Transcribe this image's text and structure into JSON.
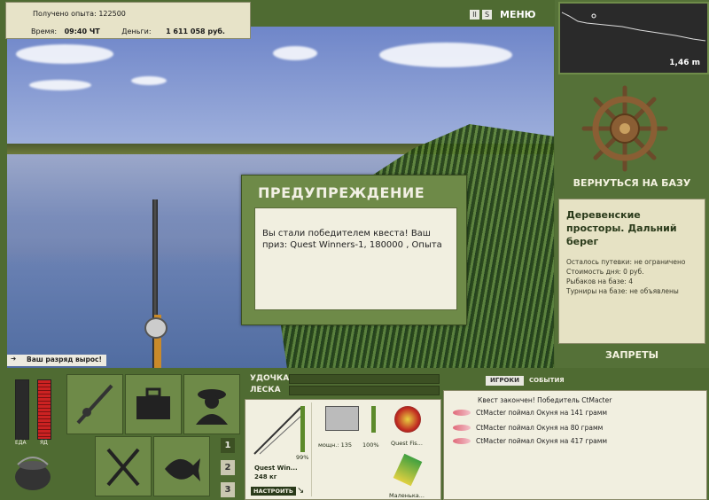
{
  "info": {
    "experience_label": "Получено опыта:",
    "experience_value": "122500",
    "time_label": "Время:",
    "time_value": "09:40 ЧТ",
    "money_label": "Деньги:",
    "money_value": "1 611 058 руб."
  },
  "top_controls": {
    "pause": "II",
    "sound": "S",
    "menu": "МЕНЮ"
  },
  "depth": {
    "value": "1,46 m"
  },
  "right_panel": {
    "return_label": "ВЕРНУТЬСЯ НА БАЗУ",
    "location_title": "Деревенские просторы. Дальний берег",
    "lines": [
      "Осталось путевки: не ограничено",
      "Стоимость дня: 0 руб.",
      "Рыбаков на базе: 4",
      "Турниры на базе: не объявлены"
    ],
    "bans_label": "ЗАПРЕТЫ"
  },
  "notification": {
    "text": "Ваш разряд вырос!"
  },
  "dialog": {
    "title": "ПРЕДУПРЕЖДЕНИЕ",
    "message": "Вы стали победителем квеста! Ваш приз: Quest Winners-1, 180000 , Опыта"
  },
  "gauges": {
    "food_label": "ЕДА",
    "poison_label": "ЯД"
  },
  "tabs": [
    "1",
    "2",
    "3"
  ],
  "bars": {
    "rod_label": "УДОЧКА",
    "line_label": "ЛЕСКА"
  },
  "tackle": {
    "rod_name": "Quest Win...",
    "rod_weight": "248 кг",
    "rod_percent": "99%",
    "reel_power": "мощн.: 135",
    "reel_percent": "100%",
    "lure1": "Quest Fis...",
    "lure2": "Маленька...",
    "tune_button": "НАСТРОИТЬ"
  },
  "events_panel": {
    "tab_players": "ИГРОКИ",
    "tab_events": "СОБЫТИЯ",
    "items": [
      "Квест закончен! Победитель CtMacter",
      "CtMacter поймал Окуня на 141 грамм",
      "CtMacter поймал Окуня на 80 грамм",
      "CtMacter поймал Окуня на 417 грамм"
    ]
  },
  "icons": {
    "rod": "fishing-rod-icon",
    "tacklebox": "tackle-box-icon",
    "fisherman": "fisherman-icon",
    "kettle": "kettle-icon",
    "cutlery": "cutlery-icon",
    "fish": "fish-icon",
    "wheel": "ship-wheel-icon"
  },
  "colors": {
    "panel_green": "#4f6b32",
    "tile_green": "#6e8a48",
    "cream": "#f1efe0",
    "gauge_red": "#c22"
  }
}
